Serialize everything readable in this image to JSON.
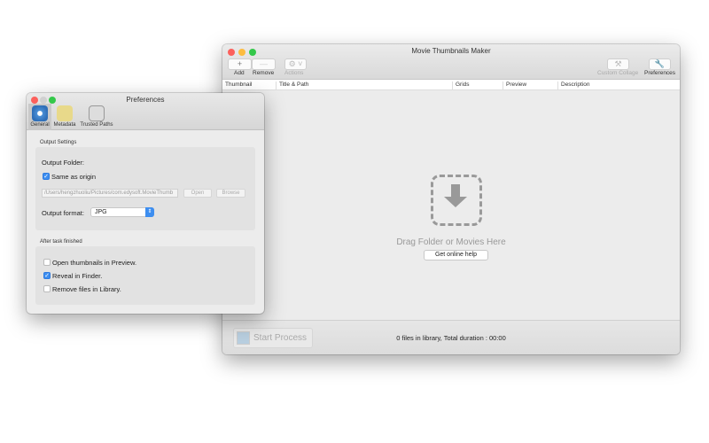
{
  "main": {
    "title": "Movie Thumbnails Maker",
    "toolbar": {
      "add": "Add",
      "remove": "Remove",
      "actions": "Actions",
      "custom_collage": "Custom Collage",
      "preferences": "Preferences",
      "add_icon": "+",
      "remove_icon": "—"
    },
    "columns": [
      "Thumbnail",
      "Title & Path",
      "Grids",
      "Preview",
      "Description"
    ],
    "drop_text": "Drag Folder or Movies Here",
    "help_button": "Get online help",
    "start_button": "Start Process",
    "status": "0 files in library, Total duration : 00:00"
  },
  "prefs": {
    "title": "Preferences",
    "tabs": [
      "General",
      "Metadata",
      "Trusted Paths"
    ],
    "output_settings": "Output Settings",
    "output_folder": "Output Folder:",
    "same_as_origin": "Same as origin",
    "path": "/Users/hengzhuoliu/Pictures/com.edysoft.MovieThumb",
    "open": "Open",
    "browse": "Browse",
    "output_format_label": "Output format:",
    "output_format": "JPG",
    "after_task": "After task finished",
    "options": [
      {
        "label": "Open thumbnails in Preview.",
        "checked": false
      },
      {
        "label": "Reveal in Finder.",
        "checked": true
      },
      {
        "label": "Remove files in Library.",
        "checked": false
      }
    ]
  },
  "colors": {
    "accent": "#3d8ef0",
    "close": "#fc605c",
    "min": "#fdbc40",
    "max": "#34c84a"
  }
}
